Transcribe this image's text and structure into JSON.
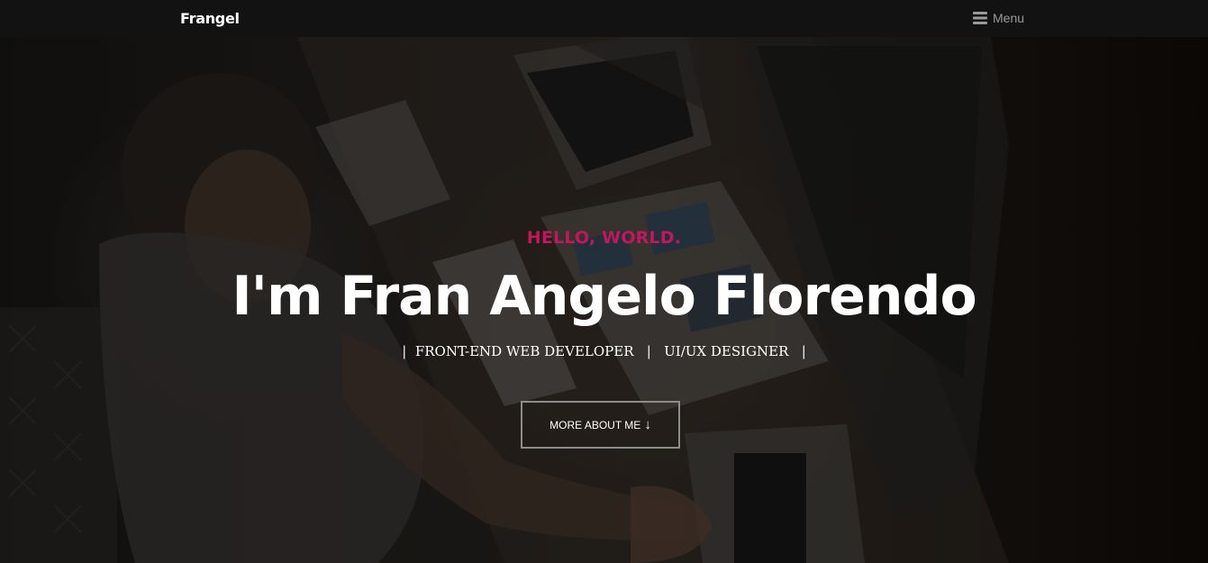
{
  "navbar": {
    "brand": "Frangel",
    "menu_label": "Menu",
    "menu_icon": "hamburger-icon"
  },
  "hero": {
    "kicker": "HELLO, WORLD.",
    "headline": "I'm Fran Angelo Florendo",
    "roles": "|  FRONT-END WEB DEVELOPER   |   UI/UX DESIGNER   |",
    "cta_label": "MORE ABOUT ME",
    "cta_icon": "arrow-down-icon",
    "background": "photo of person working at a desk with laptops"
  },
  "colors": {
    "accent": "#c2185b",
    "navbar_bg": "#121212",
    "text": "#ffffff"
  }
}
